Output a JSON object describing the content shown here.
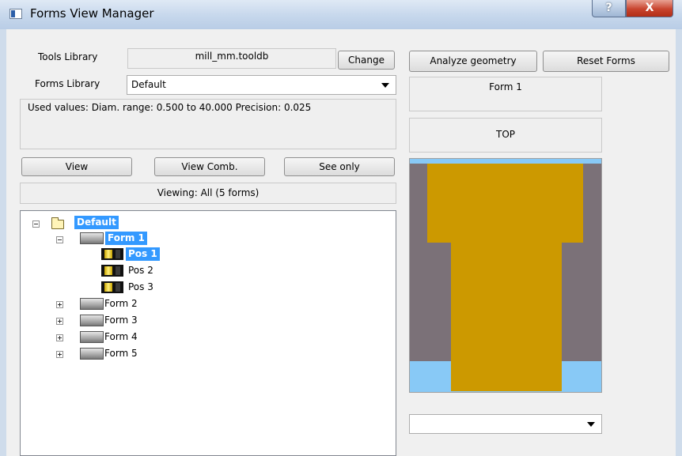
{
  "window": {
    "title": "Forms View Manager",
    "help_label": "?",
    "close_label": "X"
  },
  "tools_library": {
    "label": "Tools Library",
    "value": "mill_mm.tooldb",
    "change_label": "Change"
  },
  "forms_library": {
    "label": "Forms Library",
    "value": "Default"
  },
  "used_values": "Used values:  Diam. range: 0.500 to 40.000  Precision: 0.025",
  "buttons": {
    "analyze": "Analyze geometry",
    "reset": "Reset Forms",
    "view": "View",
    "view_comb": "View Comb.",
    "see_only": "See only"
  },
  "viewing_status": "Viewing: All (5 forms)",
  "tree": {
    "root": "Default",
    "forms": [
      {
        "label": "Form 1",
        "expanded": true,
        "positions": [
          "Pos 1",
          "Pos 2",
          "Pos 3"
        ]
      },
      {
        "label": "Form 2",
        "expanded": false
      },
      {
        "label": "Form 3",
        "expanded": false
      },
      {
        "label": "Form 4",
        "expanded": false
      },
      {
        "label": "Form 5",
        "expanded": false
      }
    ],
    "selected": [
      "Default",
      "Form 1",
      "Pos 1"
    ]
  },
  "preview": {
    "form_name": "Form 1",
    "view_name": "TOP",
    "view_selector_value": "",
    "colors": {
      "background": "#7b7178",
      "stock": "#88c9f6",
      "tool": "#cc9900"
    }
  },
  "icons": {
    "title": "window-icon",
    "folder": "folder-icon",
    "form": "form-icon",
    "position": "position-icon"
  }
}
